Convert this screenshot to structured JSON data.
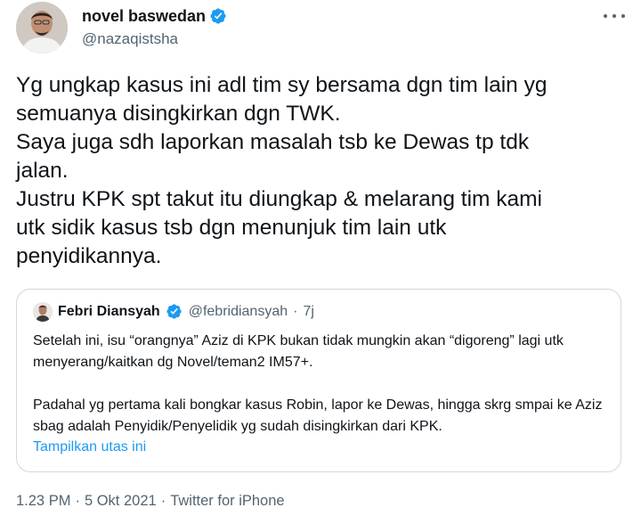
{
  "author": {
    "display_name": "novel baswedan",
    "handle": "@nazaqistsha"
  },
  "tweet": {
    "text": "Yg ungkap kasus ini adl tim sy bersama dgn tim lain yg\nsemuanya disingkirkan dgn TWK.\nSaya juga sdh laporkan masalah tsb ke Dewas tp tdk\njalan.\nJustru KPK spt takut itu diungkap & melarang tim kami\nutk sidik kasus tsb dgn menunjuk tim lain utk\npenyidikannya."
  },
  "quoted": {
    "display_name": "Febri Diansyah",
    "handle": "@febridiansyah",
    "separator": "·",
    "time": "7j",
    "paragraph_1": "Setelah ini, isu “orangnya” Aziz di KPK bukan tidak mungkin akan “digoreng” lagi utk menyerang/kaitkan dg Novel/teman2 IM57+.",
    "paragraph_2": "Padahal yg pertama kali bongkar kasus Robin, lapor ke Dewas, hingga skrg smpai ke Aziz sbag adalah Penyidik/Penyelidik yg sudah disingkirkan dari KPK.",
    "show_thread": "Tampilkan utas ini"
  },
  "meta": {
    "time": "1.23 PM",
    "dot1": "·",
    "date": "5 Okt 2021",
    "dot2": "·",
    "source": "Twitter for iPhone"
  },
  "colors": {
    "verified": "#1d9bf0",
    "link": "#1d9bf0",
    "muted": "#536471",
    "border": "#cfd9de"
  }
}
